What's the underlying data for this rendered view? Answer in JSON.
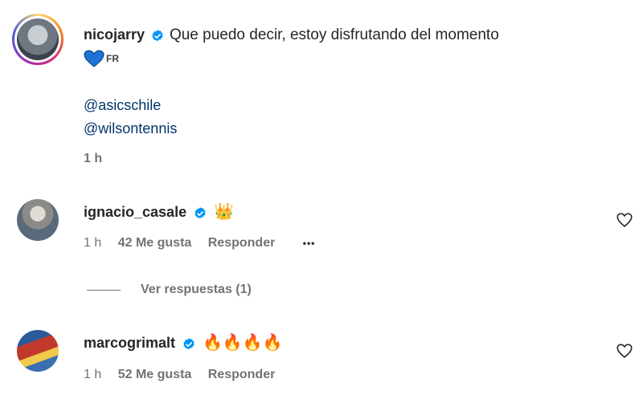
{
  "post": {
    "username": "nicojarry",
    "caption": "Que puedo decir, estoy disfrutando del momento",
    "flag_text": "FR",
    "mention1": "@asicschile",
    "mention2": "@wilsontennis",
    "time": "1 h"
  },
  "comments": [
    {
      "username": "ignacio_casale",
      "text": "👑",
      "time": "1 h",
      "likes": "42 Me gusta",
      "reply": "Responder",
      "more": "•••"
    },
    {
      "username": "marcogrimalt",
      "text": "🔥🔥🔥🔥",
      "time": "1 h",
      "likes": "52 Me gusta",
      "reply": "Responder"
    }
  ],
  "view_replies": "Ver respuestas (1)",
  "colors": {
    "verified": "#0095f6",
    "link": "#00376b",
    "secondary": "#737373"
  },
  "icons": [
    "verified-badge-icon",
    "blue-heart-icon",
    "heart-outline-icon",
    "more-options-icon"
  ]
}
